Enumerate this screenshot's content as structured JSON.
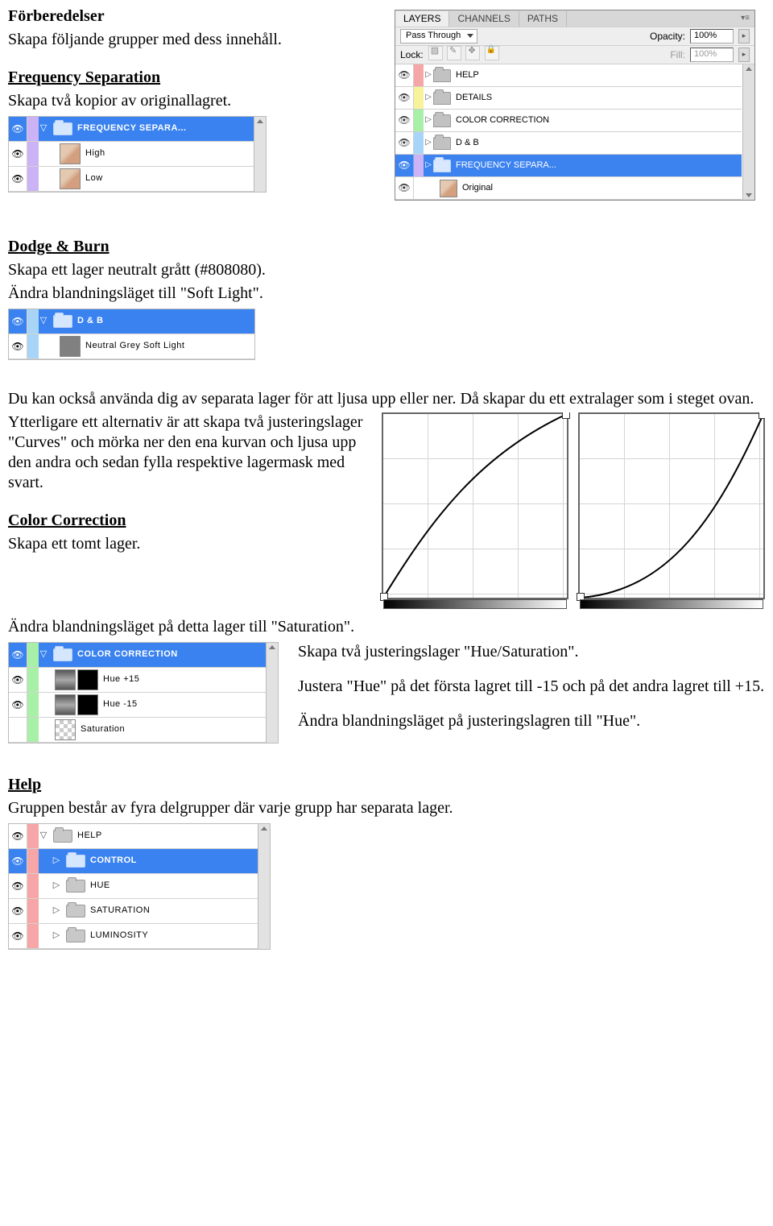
{
  "doc": {
    "h1": "Förberedelser",
    "p1": "Skapa följande grupper med dess innehåll.",
    "fs_h": "Frequency Separation",
    "fs_p": "Skapa två kopior av originallagret.",
    "db_h": "Dodge & Burn",
    "db_p1": "Skapa ett lager neutralt grått (#808080).",
    "db_p2": "Ändra blandningsläget till \"Soft Light\".",
    "db_p3": "Du kan också använda dig av separata lager för att ljusa upp eller ner. Då skapar du ett extralager som i steget ovan.",
    "db_p4": "Ytterligare ett alternativ är att skapa två justeringslager \"Curves\" och mörka ner den ena kurvan och ljusa upp den andra och sedan fylla respektive lagermask med svart.",
    "cc_h": "Color Correction",
    "cc_p1": "Skapa ett tomt lager.",
    "cc_p2": "Ändra blandningsläget på detta lager till \"Saturation\".",
    "cc_p3": "Skapa två justeringslager \"Hue/Saturation\".",
    "cc_p4": "Justera \"Hue\" på det första lagret till -15 och på det andra lagret till +15.",
    "cc_p5": "Ändra blandningsläget på justeringslagren till \"Hue\".",
    "help_h": "Help",
    "help_p": "Gruppen består av fyra delgrupper där varje grupp har separata lager."
  },
  "layers_panel": {
    "tabs": {
      "layers": "LAYERS",
      "channels": "CHANNELS",
      "paths": "PATHS"
    },
    "blend_label": "Pass Through",
    "opacity_label": "Opacity:",
    "opacity_value": "100%",
    "lock_label": "Lock:",
    "fill_label": "Fill:",
    "fill_value": "100%",
    "items": [
      {
        "name": "HELP",
        "color": "#f6a6a6",
        "sel": false,
        "thumb": "folder",
        "arrow": "▷"
      },
      {
        "name": "DETAILS",
        "color": "#f7f39a",
        "sel": false,
        "thumb": "folder",
        "arrow": "▷"
      },
      {
        "name": "COLOR CORRECTION",
        "color": "#a8f0a8",
        "sel": false,
        "thumb": "folder",
        "arrow": "▷"
      },
      {
        "name": "D & B",
        "color": "#a8d5f7",
        "sel": false,
        "thumb": "folder",
        "arrow": "▷"
      },
      {
        "name": "FREQUENCY SEPARA...",
        "color": "#cbb3f5",
        "sel": true,
        "thumb": "folder",
        "arrow": "▷"
      },
      {
        "name": "Original",
        "color": "transparent",
        "sel": false,
        "thumb": "image",
        "arrow": ""
      }
    ]
  },
  "panel_freq": {
    "stripe": "#cbb3f5",
    "head": "FREQUENCY SEPARA...",
    "rows": [
      {
        "label": "High",
        "thumb": "image"
      },
      {
        "label": "Low",
        "thumb": "image"
      }
    ]
  },
  "panel_db": {
    "stripe": "#a8d5f7",
    "head": "D & B",
    "rows": [
      {
        "label": "Neutral Grey Soft Light",
        "thumb": "grey"
      }
    ]
  },
  "panel_cc": {
    "stripe": "#a8f0a8",
    "head": "COLOR CORRECTION",
    "rows": [
      {
        "label": "Hue +15",
        "thumb": "grad",
        "mask": "black"
      },
      {
        "label": "Hue -15",
        "thumb": "grad",
        "mask": "black"
      },
      {
        "label": "Saturation",
        "thumb": "check"
      }
    ]
  },
  "panel_help": {
    "stripe": "#f6a6a6",
    "head": "HELP",
    "rows": [
      {
        "label": "CONTROL",
        "sel": true
      },
      {
        "label": "HUE",
        "sel": false
      },
      {
        "label": "SATURATION",
        "sel": false
      },
      {
        "label": "LUMINOSITY",
        "sel": false
      }
    ]
  },
  "chart_data": [
    {
      "type": "line",
      "title": "",
      "xlabel": "",
      "ylabel": "",
      "xlim": [
        0,
        255
      ],
      "ylim": [
        0,
        255
      ],
      "note": "Curves adjustment — lighten",
      "series": [
        {
          "name": "curve",
          "points": [
            [
              0,
              0
            ],
            [
              64,
              110
            ],
            [
              128,
              185
            ],
            [
              192,
              235
            ],
            [
              255,
              255
            ]
          ]
        }
      ]
    },
    {
      "type": "line",
      "title": "",
      "xlabel": "",
      "ylabel": "",
      "xlim": [
        0,
        255
      ],
      "ylim": [
        0,
        255
      ],
      "note": "Curves adjustment — darken",
      "series": [
        {
          "name": "curve",
          "points": [
            [
              0,
              0
            ],
            [
              64,
              20
            ],
            [
              128,
              65
            ],
            [
              192,
              150
            ],
            [
              255,
              255
            ]
          ]
        }
      ]
    }
  ]
}
